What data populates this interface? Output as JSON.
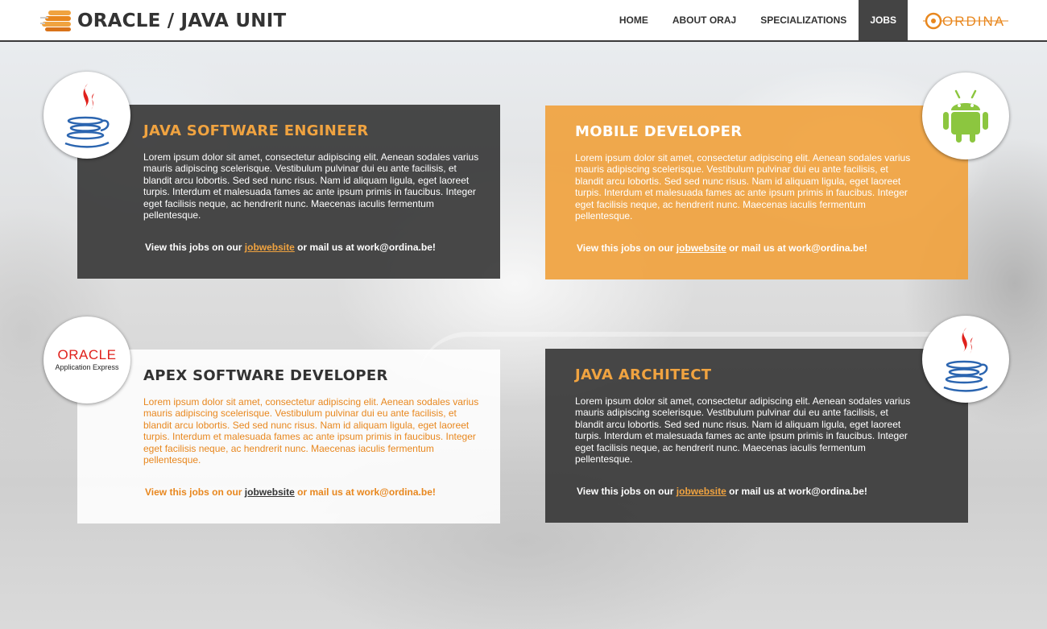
{
  "header": {
    "logo_text": "ORACLE / JAVA UNIT",
    "logo_icon": "stacked-disks-icon",
    "nav": [
      {
        "label": "HOME",
        "active": false
      },
      {
        "label": "ABOUT ORAJ",
        "active": false
      },
      {
        "label": "SPECIALIZATIONS",
        "active": false
      },
      {
        "label": "JOBS",
        "active": true
      }
    ],
    "brand_text": "ORDINA"
  },
  "jobs": [
    {
      "title": "JAVA SOFTWARE ENGINEER",
      "icon": "java-cup-icon",
      "description": "Lorem ipsum dolor sit amet, consectetur adipiscing elit. Aenean sodales varius mauris adipiscing scelerisque. Vestibulum pulvinar dui eu ante facilisis, et blandit arcu lobortis. Sed sed nunc risus. Nam id aliquam ligula, eget laoreet turpis. Interdum et malesuada fames ac ante ipsum primis in faucibus. Integer eget facilisis neque, ac hendrerit nunc. Maecenas iaculis fermentum pellentesque.",
      "link_prefix": "View this jobs on our ",
      "link_text": "jobwebsite",
      "link_suffix": " or mail us at work@ordina.be!"
    },
    {
      "title": "MOBILE DEVELOPER",
      "icon": "android-icon",
      "description": "Lorem ipsum dolor sit amet, consectetur adipiscing elit. Aenean sodales varius mauris adipiscing scelerisque. Vestibulum pulvinar dui eu ante facilisis, et blandit arcu lobortis. Sed sed nunc risus. Nam id aliquam ligula, eget laoreet turpis. Interdum et malesuada fames ac ante ipsum primis in faucibus. Integer eget facilisis neque, ac hendrerit nunc. Maecenas iaculis fermentum pellentesque.",
      "link_prefix": "View this jobs on our ",
      "link_text": "jobwebsite",
      "link_suffix": " or mail us at work@ordina.be!"
    },
    {
      "title": "APEX SOFTWARE DEVELOPER",
      "icon": "oracle-apex-logo",
      "logo_word": "ORACLE",
      "logo_sub": "Application Express",
      "description": "Lorem ipsum dolor sit amet, consectetur adipiscing elit. Aenean sodales varius mauris adipiscing scelerisque. Vestibulum pulvinar dui eu ante facilisis, et blandit arcu lobortis. Sed sed nunc risus. Nam id aliquam ligula, eget laoreet turpis. Interdum et malesuada fames ac ante ipsum primis in faucibus. Integer eget facilisis neque, ac hendrerit nunc. Maecenas iaculis fermentum pellentesque.",
      "link_prefix": "View this jobs on our ",
      "link_text": "jobwebsite",
      "link_suffix": " or mail us at work@ordina.be!"
    },
    {
      "title": "JAVA ARCHITECT",
      "icon": "java-cup-icon",
      "description": "Lorem ipsum dolor sit amet, consectetur adipiscing elit. Aenean sodales varius mauris adipiscing scelerisque. Vestibulum pulvinar dui eu ante facilisis, et blandit arcu lobortis. Sed sed nunc risus. Nam id aliquam ligula, eget laoreet turpis. Interdum et malesuada fames ac ante ipsum primis in faucibus. Integer eget facilisis neque, ac hendrerit nunc. Maecenas iaculis fermentum pellentesque.",
      "link_prefix": "View this jobs on our ",
      "link_text": "jobwebsite",
      "link_suffix": " or mail us at work@ordina.be!"
    }
  ],
  "colors": {
    "accent_orange": "#f0a340",
    "dark_panel": "#3a3a3a",
    "nav_active": "#444444",
    "oracle_red": "#e0201b",
    "android_green": "#8cc63f",
    "java_blue": "#2b65b0",
    "java_red": "#e0201b"
  }
}
